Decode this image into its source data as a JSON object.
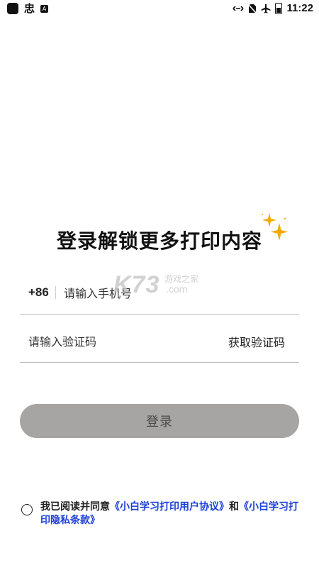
{
  "status_bar": {
    "app_glyph": "忠",
    "badge": "A",
    "time": "11:22",
    "icons": [
      "data-transfer-icon",
      "no-sim-icon",
      "airplane-mode-icon",
      "battery-icon"
    ]
  },
  "headline": "登录解锁更多打印内容",
  "watermark": {
    "main": "K73",
    "line1": "游戏之家",
    "line2": ".com"
  },
  "phone": {
    "prefix": "+86",
    "placeholder": "请输入手机号"
  },
  "code": {
    "placeholder": "请输入验证码",
    "get_code_label": "获取验证码"
  },
  "login": {
    "label": "登录"
  },
  "agreement": {
    "prefix": "我已阅读并同意",
    "user_agreement": "《小白学习打印用户协议》",
    "conjunction": "和",
    "privacy_policy": "《小白学习打印隐私条款》"
  },
  "colors": {
    "link": "#1a3fd6",
    "button_disabled": "#a7a4a4",
    "sparkle": "#f2a900"
  }
}
